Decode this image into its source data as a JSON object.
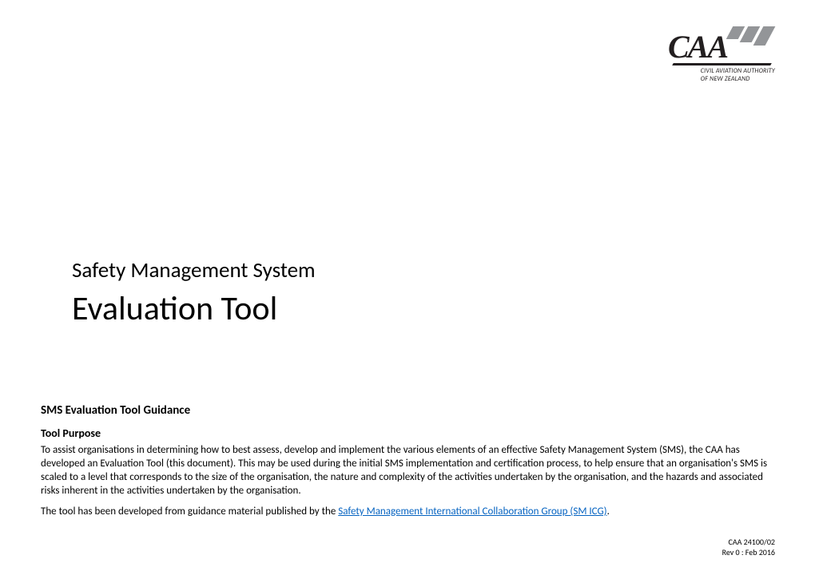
{
  "logo": {
    "mark": "CAA",
    "sub_line1": "CIVIL AVIATION AUTHORITY",
    "sub_line2": "OF NEW ZEALAND"
  },
  "title": {
    "super": "Safety Management System",
    "main": "Evaluation Tool"
  },
  "body": {
    "section_heading": "SMS Evaluation Tool Guidance",
    "sub_heading": "Tool Purpose",
    "para1": "To assist organisations in determining how to best assess, develop and implement the various elements of an effective Safety Management System (SMS), the CAA has developed an Evaluation Tool (this document).  This may be used during the initial SMS implementation and certification process, to help ensure that an organisation's SMS is scaled to a level that corresponds to the size of the organisation, the nature and complexity of the activities undertaken by the organisation, and the hazards and associated risks inherent in the activities undertaken by the organisation.",
    "para2_prefix": "The tool has been developed from guidance material published by the ",
    "para2_link": "Safety Management International Collaboration Group (SM ICG)",
    "para2_suffix": "."
  },
  "footer": {
    "code": "CAA 24100/02",
    "rev": "Rev 0 : Feb 2016"
  }
}
